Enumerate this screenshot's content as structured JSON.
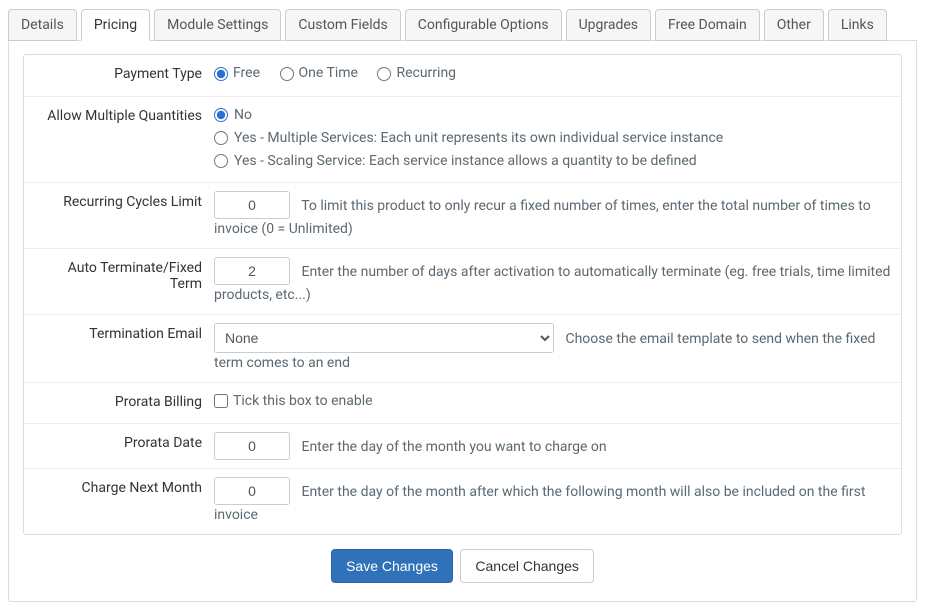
{
  "tabs": [
    {
      "label": "Details"
    },
    {
      "label": "Pricing"
    },
    {
      "label": "Module Settings"
    },
    {
      "label": "Custom Fields"
    },
    {
      "label": "Configurable Options"
    },
    {
      "label": "Upgrades"
    },
    {
      "label": "Free Domain"
    },
    {
      "label": "Other"
    },
    {
      "label": "Links"
    }
  ],
  "activeTab": "Pricing",
  "paymentType": {
    "label": "Payment Type",
    "options": {
      "free": "Free",
      "onetime": "One Time",
      "recurring": "Recurring"
    },
    "selected": "free"
  },
  "allowMultiple": {
    "label": "Allow Multiple Quantities",
    "options": {
      "no": "No",
      "multiple": "Yes - Multiple Services: Each unit represents its own individual service instance",
      "scaling": "Yes - Scaling Service: Each service instance allows a quantity to be defined"
    },
    "selected": "no"
  },
  "recurringCycles": {
    "label": "Recurring Cycles Limit",
    "value": "0",
    "help": "To limit this product to only recur a fixed number of times, enter the total number of times to invoice (0 = Unlimited)"
  },
  "autoTerminate": {
    "label": "Auto Terminate/Fixed Term",
    "value": "2",
    "help": "Enter the number of days after activation to automatically terminate (eg. free trials, time limited products, etc...)"
  },
  "terminationEmail": {
    "label": "Termination Email",
    "selected": "None",
    "help": "Choose the email template to send when the fixed term comes to an end"
  },
  "prorataBilling": {
    "label": "Prorata Billing",
    "checked": false,
    "help": "Tick this box to enable"
  },
  "prorataDate": {
    "label": "Prorata Date",
    "value": "0",
    "help": "Enter the day of the month you want to charge on"
  },
  "chargeNextMonth": {
    "label": "Charge Next Month",
    "value": "0",
    "help": "Enter the day of the month after which the following month will also be included on the first invoice"
  },
  "actions": {
    "save": "Save Changes",
    "cancel": "Cancel Changes"
  }
}
